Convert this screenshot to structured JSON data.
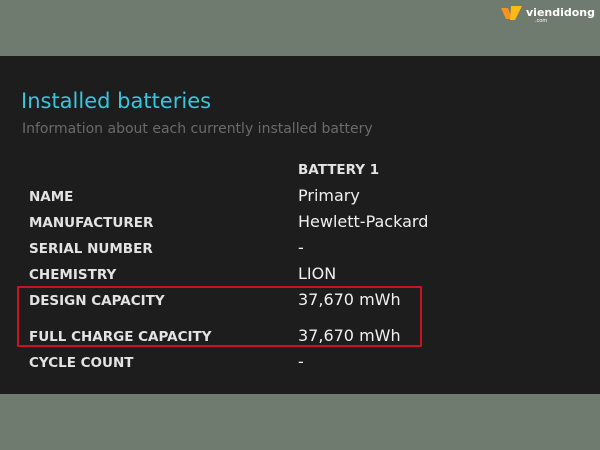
{
  "watermark": {
    "brand": "viendidong",
    "sub": ".com",
    "icon": "viendidong-logo-icon",
    "colors": {
      "orange": "#f7941d",
      "yellow": "#fdb913"
    }
  },
  "section": {
    "title": "Installed batteries",
    "subtitle": "Information about each currently installed battery"
  },
  "table": {
    "column_header": "BATTERY 1",
    "rows": [
      {
        "label": "NAME",
        "value": "Primary"
      },
      {
        "label": "MANUFACTURER",
        "value": "Hewlett-Packard"
      },
      {
        "label": "SERIAL NUMBER",
        "value": "-"
      },
      {
        "label": "CHEMISTRY",
        "value": "LION"
      },
      {
        "label": "DESIGN CAPACITY",
        "value": "37,670 mWh"
      },
      {
        "label": "FULL CHARGE CAPACITY",
        "value": "37,670 mWh"
      },
      {
        "label": "CYCLE COUNT",
        "value": "-"
      }
    ]
  },
  "colors": {
    "background": "#6f7b6f",
    "panel": "#1d1d1d",
    "title": "#35c7dd",
    "highlight_box": "#c8141e"
  }
}
